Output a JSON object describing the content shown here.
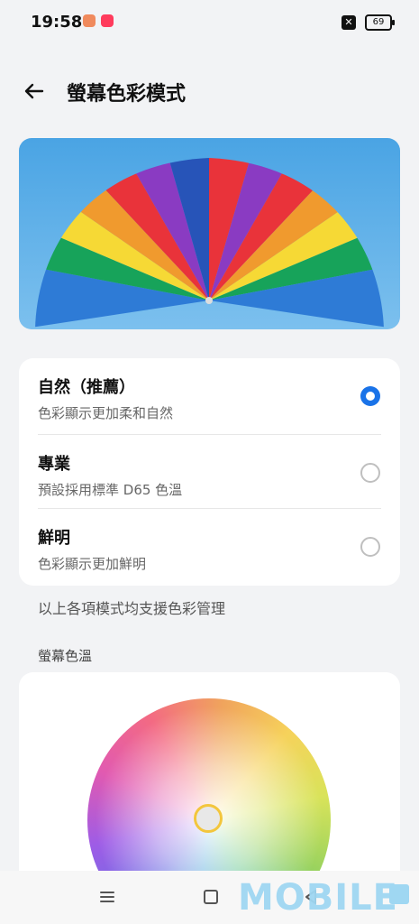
{
  "status_bar": {
    "time": "19:58",
    "battery": "69"
  },
  "header": {
    "title": "螢幕色彩模式"
  },
  "options": [
    {
      "title": "自然（推薦）",
      "subtitle": "色彩顯示更加柔和自然",
      "selected": true
    },
    {
      "title": "專業",
      "subtitle": "預設採用標準 D65 色溫",
      "selected": false
    },
    {
      "title": "鮮明",
      "subtitle": "色彩顯示更加鮮明",
      "selected": false
    }
  ],
  "note": "以上各項模式均支援色彩管理",
  "section": {
    "label": "螢幕色溫"
  },
  "watermark": "MOBILE",
  "colors": {
    "accent": "#1a73e8",
    "handle_ring": "#f3c63d",
    "background": "#f2f3f5"
  }
}
